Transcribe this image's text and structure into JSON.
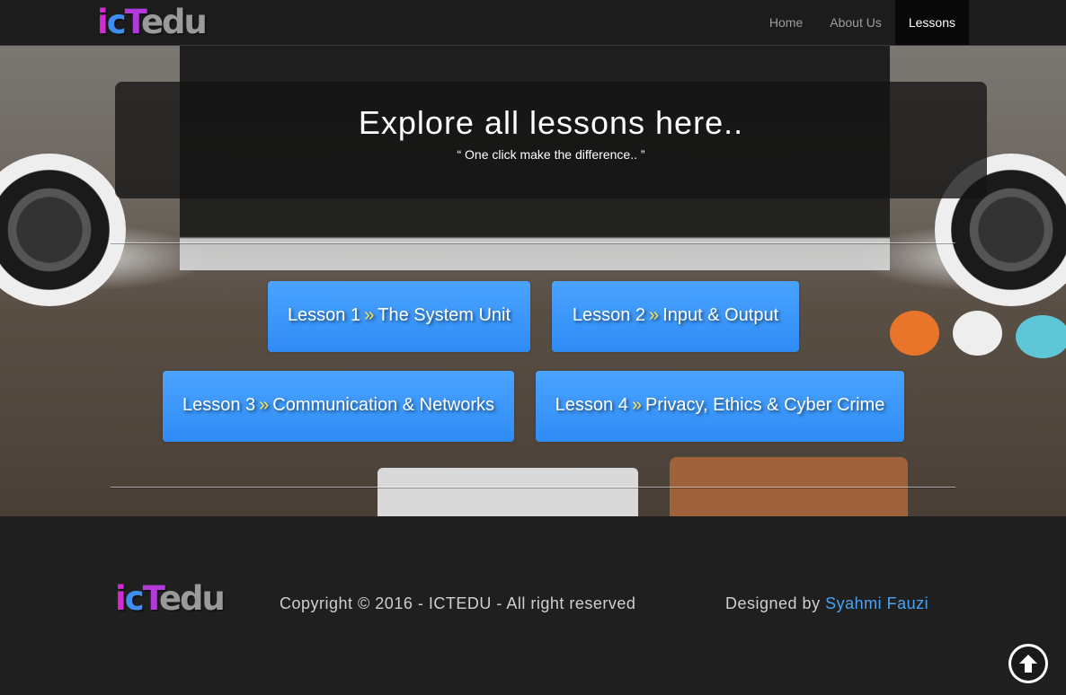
{
  "brand": {
    "logo_parts": [
      "i",
      "c",
      "T",
      "edu"
    ],
    "colors": {
      "i": "#d42ad6",
      "c": "#3d8ef0",
      "T": "#b13ad8",
      "edu": "#9a9a9a"
    }
  },
  "nav": {
    "items": [
      {
        "label": "Home",
        "active": false
      },
      {
        "label": "About Us",
        "active": false
      },
      {
        "label": "Lessons",
        "active": true
      }
    ]
  },
  "banner": {
    "title": "Explore all lessons here..",
    "subtitle": "“ One click make the difference.. ”"
  },
  "lessons": [
    {
      "number": "Lesson 1",
      "separator": "»",
      "title": "The System Unit"
    },
    {
      "number": "Lesson 2",
      "separator": "»",
      "title": "Input & Output"
    },
    {
      "number": "Lesson 3",
      "separator": "»",
      "title": "Communication & Networks"
    },
    {
      "number": "Lesson 4",
      "separator": "»",
      "title": "Privacy, Ethics & Cyber Crime"
    }
  ],
  "footer": {
    "copyright": "Copyright © 2016 - ICTEDU - All right reserved",
    "designed_prefix": "Designed by ",
    "designer": "Syahmi Fauzi"
  },
  "scroll_top": {
    "icon": "arrow-up-icon"
  },
  "theme": {
    "accent": "#3d95f8",
    "highlight": "#ffe14a",
    "link": "#4aa3f0"
  }
}
